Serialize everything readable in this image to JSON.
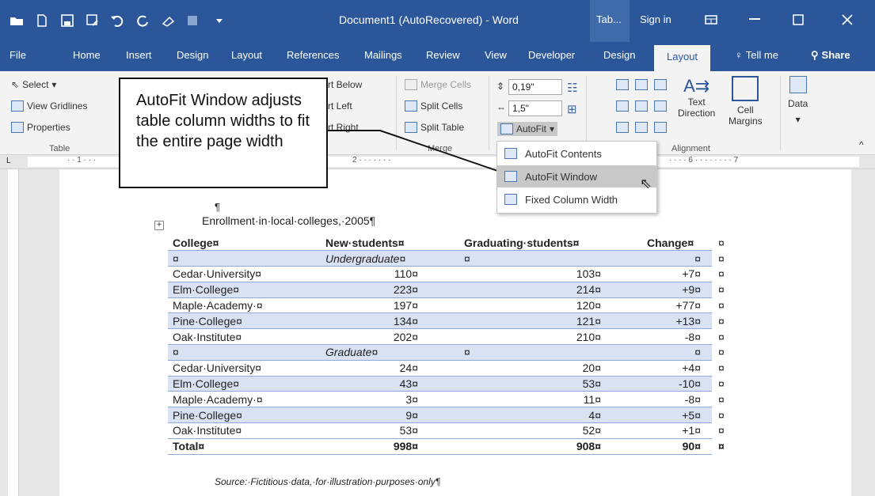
{
  "window": {
    "title": "Document1 (AutoRecovered) - Word",
    "context_tab": "Tab...",
    "sign_in": "Sign in"
  },
  "tabs": [
    "File",
    "Home",
    "Insert",
    "Design",
    "Layout",
    "References",
    "Mailings",
    "Review",
    "View",
    "Developer",
    "Design",
    "Layout"
  ],
  "tell_me": "Tell me",
  "share": "Share",
  "ribbon": {
    "table_group": {
      "select": "Select",
      "view_gridlines": "View Gridlines",
      "properties": "Properties",
      "label": "Table"
    },
    "rows_cols": {
      "insert_below": "rt Below",
      "insert_left": "rt Left",
      "insert_right": "rt Right"
    },
    "merge_group": {
      "merge_cells": "Merge Cells",
      "split_cells": "Split Cells",
      "split_table": "Split Table",
      "label": "Merge"
    },
    "cell_size": {
      "height": "0,19\"",
      "width": "1,5\"",
      "autofit": "AutoFit"
    },
    "alignment": {
      "text_direction_1": "Text",
      "text_direction_2": "Direction",
      "cell_margins_1": "Cell",
      "cell_margins_2": "Margins",
      "label": "Alignment"
    },
    "data": "Data"
  },
  "callout": {
    "text": "AutoFit Window adjusts table column widths to fit the entire page width"
  },
  "autofit_menu": [
    {
      "label": "AutoFit Contents",
      "icon": "autofit-contents-icon"
    },
    {
      "label": "AutoFit Window",
      "icon": "autofit-window-icon"
    },
    {
      "label": "Fixed Column Width",
      "icon": "fixed-column-width-icon"
    }
  ],
  "ruler": {
    "ticks": "· · 1 · · ·",
    "mid": "2 · · · · · · ·",
    "right": "· · · · 6 · · · · · · · · 7"
  },
  "doc": {
    "pilcrow": "¶",
    "caption": "Enrollment·in·local·colleges,·2005¶",
    "source": "Source:·Fictitious·data,·for·illustration·purposes·only¶",
    "end_cell_mark": "¤",
    "headers": [
      "College¤",
      "New·students¤",
      "Graduating·students¤",
      "Change¤"
    ],
    "rows": [
      [
        "¤",
        "Undergraduate¤",
        "¤",
        "¤"
      ],
      [
        "Cedar·University¤",
        "110¤",
        "103¤",
        "+7¤"
      ],
      [
        "Elm·College¤",
        "223¤",
        "214¤",
        "+9¤"
      ],
      [
        "Maple·Academy·¤",
        "197¤",
        "120¤",
        "+77¤"
      ],
      [
        "Pine·College¤",
        "134¤",
        "121¤",
        "+13¤"
      ],
      [
        "Oak·Institute¤",
        "202¤",
        "210¤",
        "-8¤"
      ],
      [
        "¤",
        "Graduate¤",
        "¤",
        "¤"
      ],
      [
        "Cedar·University¤",
        "24¤",
        "20¤",
        "+4¤"
      ],
      [
        "Elm·College¤",
        "43¤",
        "53¤",
        "-10¤"
      ],
      [
        "Maple·Academy·¤",
        "3¤",
        "11¤",
        "-8¤"
      ],
      [
        "Pine·College¤",
        "9¤",
        "4¤",
        "+5¤"
      ],
      [
        "Oak·Institute¤",
        "53¤",
        "52¤",
        "+1¤"
      ]
    ],
    "total": [
      "Total¤",
      "998¤",
      "908¤",
      "90¤"
    ]
  },
  "colors": {
    "accent": "#2b579a",
    "band": "#d9e2f3",
    "border": "#8eaadb"
  }
}
